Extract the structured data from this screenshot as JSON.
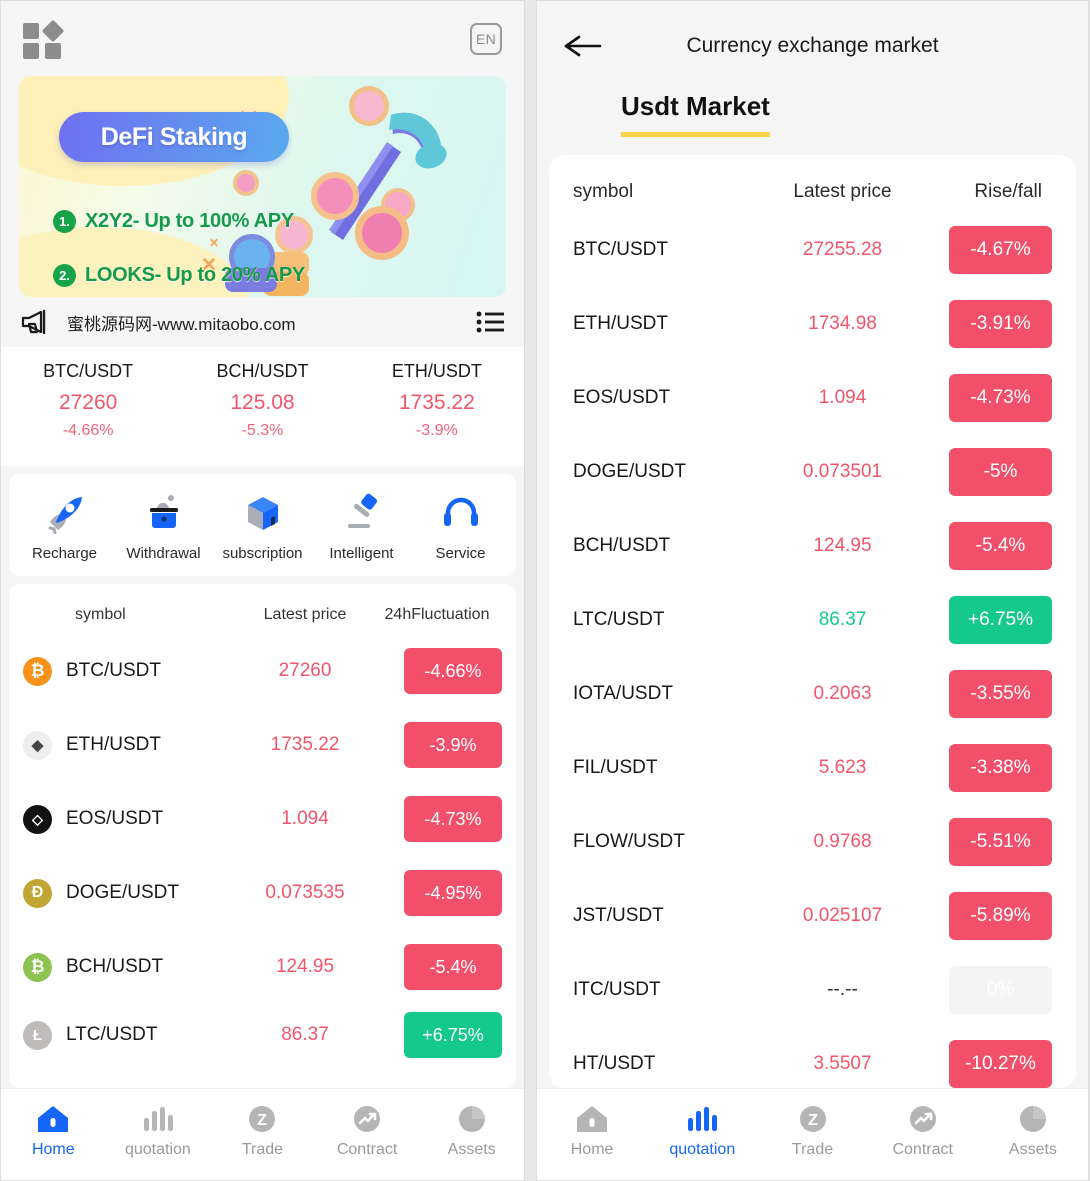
{
  "left": {
    "topbar": {
      "grid_icon": "grid-icon",
      "lang_label": "EN"
    },
    "banner": {
      "title": "DeFi Staking",
      "items": [
        {
          "num": "1.",
          "text": "X2Y2- Up to 100% APY"
        },
        {
          "num": "2.",
          "text": "LOOKS- Up to 20% APY"
        }
      ]
    },
    "notice": {
      "icon": "megaphone-icon",
      "text": "蜜桃源码网-www.mitaobo.com",
      "list_icon": "list-icon"
    },
    "ticker": [
      {
        "symbol": "BTC/USDT",
        "price": "27260",
        "change": "-4.66%"
      },
      {
        "symbol": "BCH/USDT",
        "price": "125.08",
        "change": "-5.3%"
      },
      {
        "symbol": "ETH/USDT",
        "price": "1735.22",
        "change": "-3.9%"
      }
    ],
    "actions": [
      {
        "label": "Recharge",
        "icon": "rocket-icon"
      },
      {
        "label": "Withdrawal",
        "icon": "wallet-withdraw-icon"
      },
      {
        "label": "subscription",
        "icon": "cube-icon"
      },
      {
        "label": "Intelligent",
        "icon": "gavel-icon"
      },
      {
        "label": "Service",
        "icon": "headset-icon"
      }
    ],
    "market_headers": {
      "symbol": "symbol",
      "price": "Latest price",
      "change": "24hFluctuation"
    },
    "market_rows": [
      {
        "symbol": "BTC/USDT",
        "price": "27260",
        "change": "-4.66%",
        "dir": "down",
        "coin": "B",
        "color": "#f7931a"
      },
      {
        "symbol": "ETH/USDT",
        "price": "1735.22",
        "change": "-3.9%",
        "dir": "down",
        "coin": "◆",
        "color": "#eeeeee"
      },
      {
        "symbol": "EOS/USDT",
        "price": "1.094",
        "change": "-4.73%",
        "dir": "down",
        "coin": "◇",
        "color": "#121212"
      },
      {
        "symbol": "DOGE/USDT",
        "price": "0.073535",
        "change": "-4.95%",
        "dir": "down",
        "coin": "Ð",
        "color": "#c2a633"
      },
      {
        "symbol": "BCH/USDT",
        "price": "124.95",
        "change": "-5.4%",
        "dir": "down",
        "coin": "B",
        "color": "#8dc351"
      },
      {
        "symbol": "LTC/USDT",
        "price": "86.37",
        "change": "+6.75%",
        "dir": "up",
        "coin": "Ł",
        "color": "#bfbbbb"
      }
    ],
    "bottom_nav": [
      {
        "label": "Home",
        "icon": "home-icon",
        "active": true
      },
      {
        "label": "quotation",
        "icon": "bars-icon",
        "active": false
      },
      {
        "label": "Trade",
        "icon": "trade-icon",
        "active": false
      },
      {
        "label": "Contract",
        "icon": "contract-icon",
        "active": false
      },
      {
        "label": "Assets",
        "icon": "pie-icon",
        "active": false
      }
    ]
  },
  "right": {
    "header": {
      "back_icon": "back-arrow-icon",
      "title": "Currency exchange market"
    },
    "tab": {
      "label": "Usdt Market",
      "underline_color": "#fbd34b"
    },
    "headers": {
      "symbol": "symbol",
      "price": "Latest price",
      "change": "Rise/fall"
    },
    "rows": [
      {
        "symbol": "BTC/USDT",
        "price": "27255.28",
        "change": "-4.67%",
        "dir": "down"
      },
      {
        "symbol": "ETH/USDT",
        "price": "1734.98",
        "change": "-3.91%",
        "dir": "down"
      },
      {
        "symbol": "EOS/USDT",
        "price": "1.094",
        "change": "-4.73%",
        "dir": "down"
      },
      {
        "symbol": "DOGE/USDT",
        "price": "0.073501",
        "change": "-5%",
        "dir": "down"
      },
      {
        "symbol": "BCH/USDT",
        "price": "124.95",
        "change": "-5.4%",
        "dir": "down"
      },
      {
        "symbol": "LTC/USDT",
        "price": "86.37",
        "change": "+6.75%",
        "dir": "up"
      },
      {
        "symbol": "IOTA/USDT",
        "price": "0.2063",
        "change": "-3.55%",
        "dir": "down"
      },
      {
        "symbol": "FIL/USDT",
        "price": "5.623",
        "change": "-3.38%",
        "dir": "down"
      },
      {
        "symbol": "FLOW/USDT",
        "price": "0.9768",
        "change": "-5.51%",
        "dir": "down"
      },
      {
        "symbol": "JST/USDT",
        "price": "0.025107",
        "change": "-5.89%",
        "dir": "down"
      },
      {
        "symbol": "ITC/USDT",
        "price": "--.--",
        "change": "0%",
        "dir": "flat"
      },
      {
        "symbol": "HT/USDT",
        "price": "3.5507",
        "change": "-10.27%",
        "dir": "down"
      }
    ],
    "bottom_nav": [
      {
        "label": "Home",
        "icon": "home-icon",
        "active": false
      },
      {
        "label": "quotation",
        "icon": "bars-icon",
        "active": true
      },
      {
        "label": "Trade",
        "icon": "trade-icon",
        "active": false
      },
      {
        "label": "Contract",
        "icon": "contract-icon",
        "active": false
      },
      {
        "label": "Assets",
        "icon": "pie-icon",
        "active": false
      }
    ]
  },
  "colors": {
    "down": "#f2506a",
    "up": "#14c98b",
    "accent_blue": "#1565f7",
    "tab_underline": "#fbd34b",
    "muted": "#9a9a9a"
  }
}
